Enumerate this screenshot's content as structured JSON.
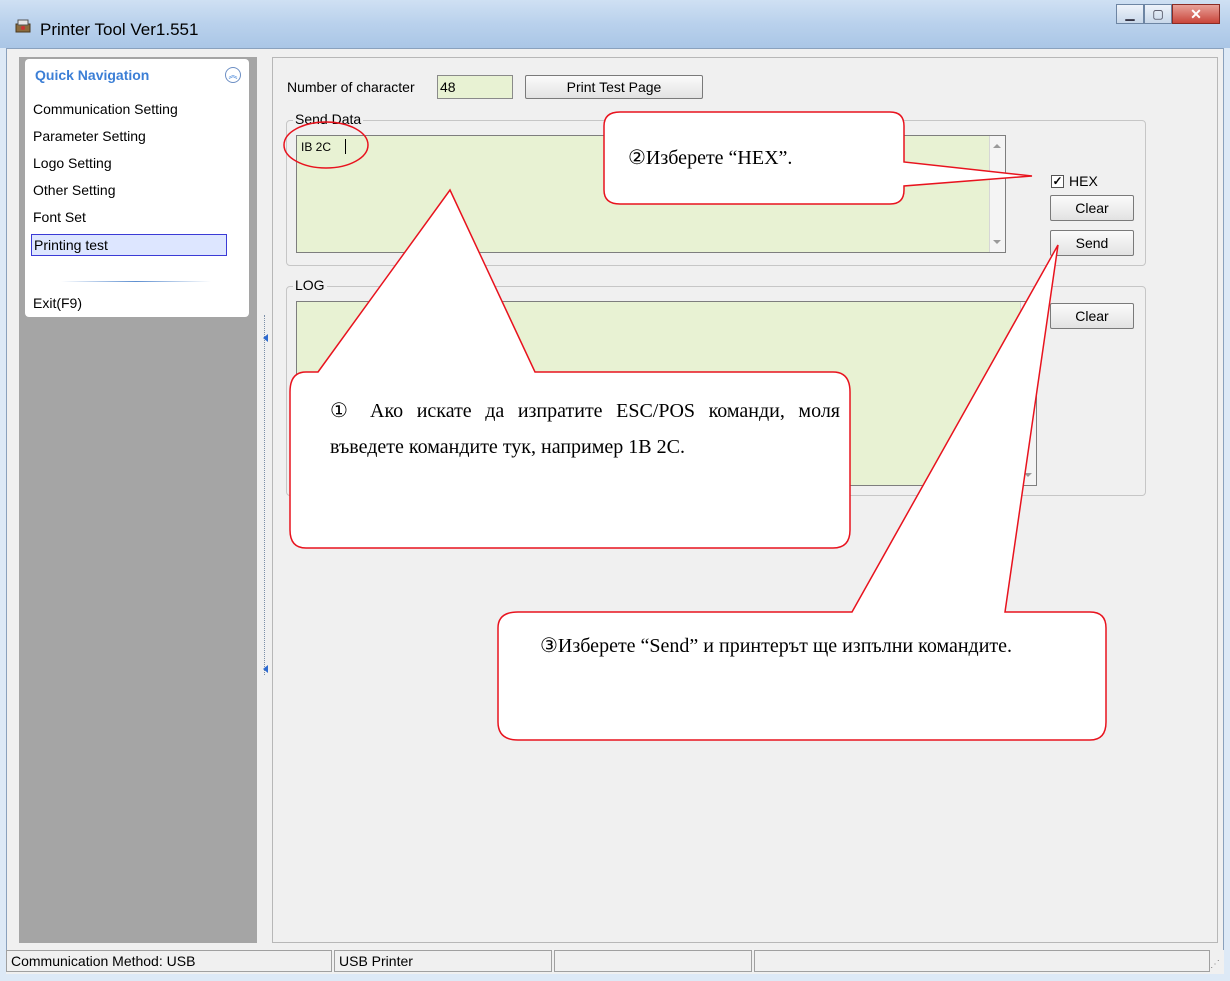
{
  "window": {
    "title": "Printer Tool Ver1.551"
  },
  "nav": {
    "header": "Quick Navigation",
    "items": [
      "Communication Setting",
      "Parameter Setting",
      "Logo Setting",
      "Other Setting",
      "Font Set",
      "Printing test"
    ],
    "selected": "Printing test",
    "exit": "Exit(F9)"
  },
  "main": {
    "num_char_label": "Number of character",
    "num_char_value": "48",
    "print_test_button": "Print Test Page",
    "send_data_title": "Send Data",
    "send_data_value": "IB 2C",
    "hex_label": "HEX",
    "hex_checked": true,
    "clear_label": "Clear",
    "send_label": "Send",
    "log_title": "LOG",
    "log_clear_label": "Clear"
  },
  "statusbar": {
    "method": "Communication Method: USB",
    "device": "USB Printer"
  },
  "callouts": {
    "step1": "① Ако искате да изпратите ESC/POS команди, моля въведете командите тук, например 1B 2C.",
    "step2": "②Изберете “HEX”.",
    "step3": "③Изберете “Send” и принтерът ще изпълни командите."
  },
  "colors": {
    "callout_border": "#e8131e",
    "input_bg": "#e8f2d3",
    "nav_header": "#3c7fd6"
  }
}
